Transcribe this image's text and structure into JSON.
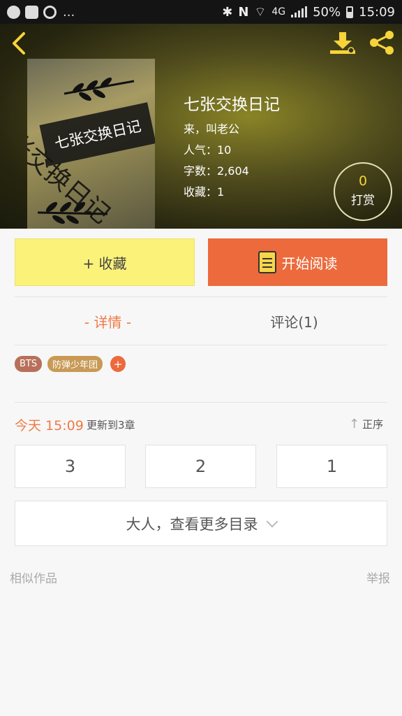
{
  "status_bar": {
    "dots": "...",
    "network": "4G",
    "battery": "50%",
    "time": "15:09"
  },
  "header": {
    "back_icon": "chevron-left-icon",
    "download_icon": "download-icon",
    "share_icon": "share-icon",
    "accent_color": "#f6d43a"
  },
  "book": {
    "cover_title": "七张交换日记",
    "cover_big_text": "张交换日记",
    "title": "七张交换日记",
    "author": "来，叫老公",
    "popularity": "人气：10",
    "word_count": "字数：2,604",
    "favorites": "收藏：1"
  },
  "tip": {
    "count": "0",
    "label": "打赏"
  },
  "actions": {
    "favorite_label": "+ 收藏",
    "read_label": "开始阅读",
    "read_color": "#ec6a3c",
    "favorite_color": "#fbf27a"
  },
  "tabs": {
    "details": "- 详情 -",
    "comments": "评论(1)"
  },
  "tags": [
    "BTS",
    "防弹少年团",
    "+"
  ],
  "update": {
    "time": "今天 15:09",
    "chapter": "更新到3章",
    "sort_label": "正序"
  },
  "chapters": [
    "3",
    "2",
    "1"
  ],
  "more_catalog": "大人，查看更多目录",
  "footer": {
    "similar": "相似作品",
    "report": "举报"
  }
}
